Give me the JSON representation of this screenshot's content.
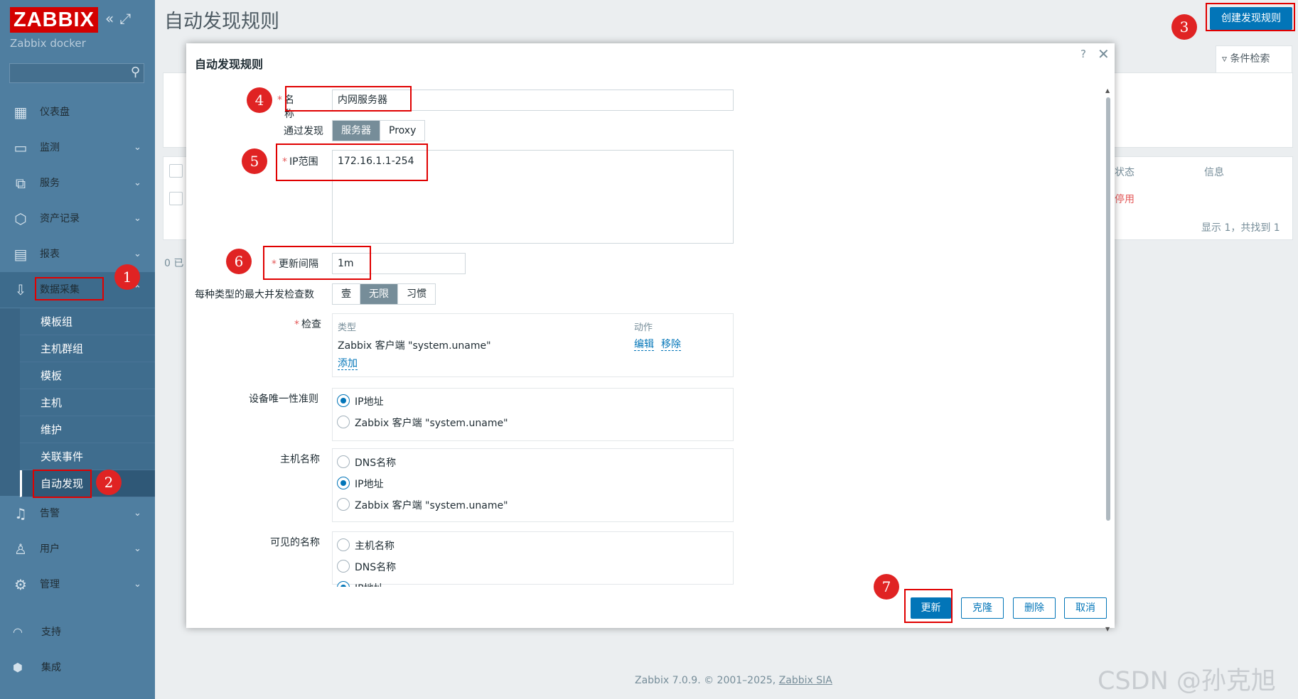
{
  "sidebar": {
    "logo": "ZABBIX",
    "server_name": "Zabbix docker",
    "collapse_icon": "«",
    "kiosk_icon": "⤢",
    "nav": [
      {
        "label": "仪表盘",
        "icon": "▦"
      },
      {
        "label": "监测",
        "icon": "▭"
      },
      {
        "label": "服务",
        "icon": "⧉"
      },
      {
        "label": "资产记录",
        "icon": "⬡"
      },
      {
        "label": "报表",
        "icon": "▤"
      },
      {
        "label": "数据采集",
        "icon": "⇩"
      },
      {
        "label": "告警",
        "icon": "♫"
      },
      {
        "label": "用户",
        "icon": "♙"
      },
      {
        "label": "管理",
        "icon": "⚙"
      }
    ],
    "submenu": [
      "模板组",
      "主机群组",
      "模板",
      "主机",
      "维护",
      "关联事件",
      "自动发现"
    ],
    "bottom": [
      {
        "label": "支持",
        "icon": "◠"
      },
      {
        "label": "集成",
        "icon": "⬢"
      }
    ]
  },
  "page": {
    "title": "自动发现规则",
    "create_button": "创建发现规则",
    "filter_tab": "条件检索",
    "table": {
      "col_status": "状态",
      "col_info": "信息",
      "row_status": "停用",
      "summary": "显示 1，共找到 1",
      "selected": "0 已"
    },
    "footer": {
      "version": "Zabbix 7.0.9. © 2001–2025,",
      "company": "Zabbix SIA"
    },
    "watermark": "CSDN @孙克旭"
  },
  "dialog": {
    "title": "自动发现规则",
    "help": "?",
    "close": "✕",
    "fields": {
      "name_label": "名称",
      "name_value": "内网服务器",
      "discovery_by_label": "通过发现",
      "discovery_by_options": [
        "服务器",
        "Proxy"
      ],
      "ip_range_label": "IP范围",
      "ip_range_value": "172.16.1.1-254",
      "interval_label": "更新间隔",
      "interval_value": "1m",
      "max_checks_label": "每种类型的最大并发检查数",
      "max_checks_options": [
        "壹",
        "无限",
        "习惯"
      ],
      "checks_label": "检查",
      "checks_col_type": "类型",
      "checks_col_action": "动作",
      "check_item": "Zabbix 客户端 \"system.uname\"",
      "check_edit": "编辑",
      "check_remove": "移除",
      "check_add": "添加",
      "uniqueness_label": "设备唯一性准则",
      "uniqueness_options": [
        "IP地址",
        "Zabbix 客户端 \"system.uname\""
      ],
      "hostname_label": "主机名称",
      "hostname_options": [
        "DNS名称",
        "IP地址",
        "Zabbix 客户端 \"system.uname\""
      ],
      "visible_name_label": "可见的名称",
      "visible_name_options": [
        "主机名称",
        "DNS名称",
        "IP地址"
      ]
    },
    "buttons": {
      "update": "更新",
      "clone": "克隆",
      "delete": "删除",
      "cancel": "取消"
    }
  },
  "annotations": [
    "1",
    "2",
    "3",
    "4",
    "5",
    "6",
    "7"
  ],
  "colors": {
    "sidebar": "#4f7ea0",
    "accent": "#0275b8",
    "annotation": "#e00000"
  }
}
